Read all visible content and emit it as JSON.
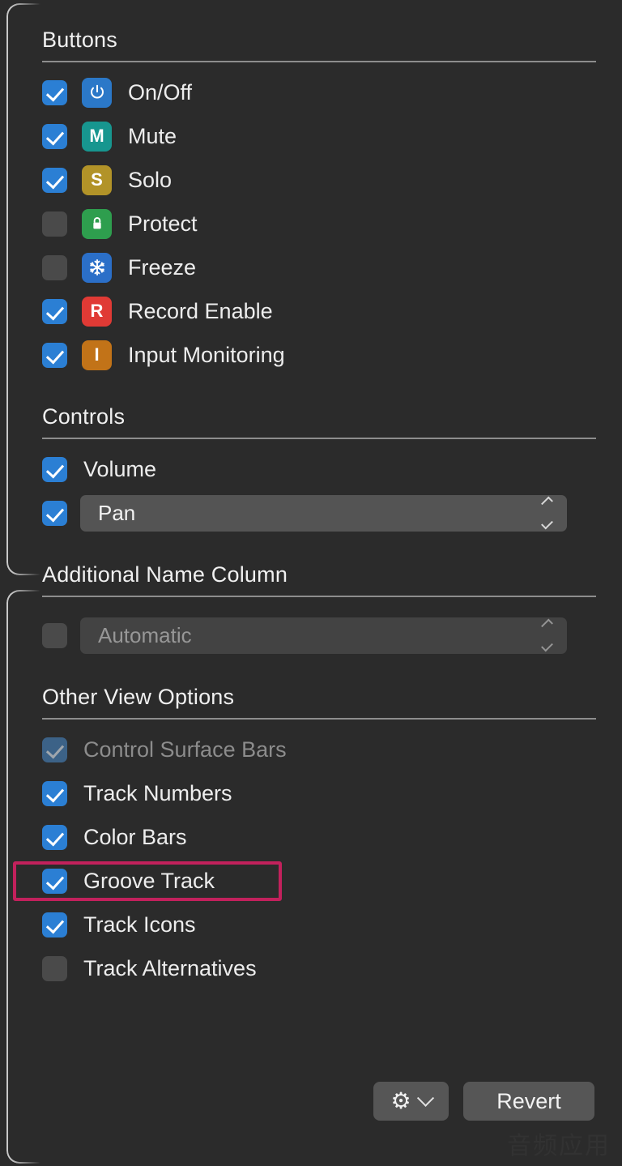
{
  "panel": {
    "background": "#2b2b2b",
    "accent_checkbox": "#2b7fd4",
    "highlight_color": "#c2215c"
  },
  "sections": {
    "buttons": {
      "title": "Buttons",
      "items": [
        {
          "label": "On/Off",
          "checked": true,
          "icon": "power-icon",
          "glyph": "⏻",
          "color": "#2b78c8"
        },
        {
          "label": "Mute",
          "checked": true,
          "icon": "mute-icon",
          "glyph": "M",
          "color": "#17968f"
        },
        {
          "label": "Solo",
          "checked": true,
          "icon": "solo-icon",
          "glyph": "S",
          "color": "#b29328"
        },
        {
          "label": "Protect",
          "checked": false,
          "icon": "lock-icon",
          "glyph": "🔒",
          "color": "#2e9e4e"
        },
        {
          "label": "Freeze",
          "checked": false,
          "icon": "snowflake-icon",
          "glyph": "❄",
          "color": "#2b6fc8"
        },
        {
          "label": "Record Enable",
          "checked": true,
          "icon": "record-icon",
          "glyph": "R",
          "color": "#e03a35"
        },
        {
          "label": "Input Monitoring",
          "checked": true,
          "icon": "input-icon",
          "glyph": "I",
          "color": "#c27318"
        }
      ]
    },
    "controls": {
      "title": "Controls",
      "volume": {
        "label": "Volume",
        "checked": true
      },
      "pan": {
        "value": "Pan",
        "checked": true,
        "enabled": true
      }
    },
    "additional_name_column": {
      "title": "Additional Name Column",
      "dropdown": {
        "value": "Automatic",
        "checked": false,
        "enabled": false
      }
    },
    "other_view_options": {
      "title": "Other View Options",
      "items": [
        {
          "label": "Control Surface Bars",
          "checked": true,
          "enabled": false,
          "highlighted": false
        },
        {
          "label": "Track Numbers",
          "checked": true,
          "enabled": true,
          "highlighted": false
        },
        {
          "label": "Color Bars",
          "checked": true,
          "enabled": true,
          "highlighted": false
        },
        {
          "label": "Groove Track",
          "checked": true,
          "enabled": true,
          "highlighted": true
        },
        {
          "label": "Track Icons",
          "checked": true,
          "enabled": true,
          "highlighted": false
        },
        {
          "label": "Track Alternatives",
          "checked": false,
          "enabled": true,
          "highlighted": false
        }
      ]
    }
  },
  "footer": {
    "action_menu_label": "",
    "revert_label": "Revert"
  },
  "watermark": {
    "text": "音频应用"
  }
}
